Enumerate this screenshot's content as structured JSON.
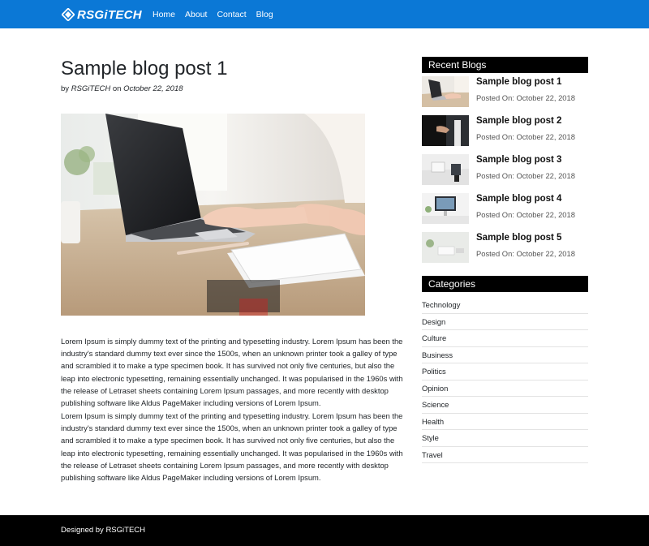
{
  "navbar": {
    "brand_text": "RSGiTECH",
    "brand_color": "#0b78d6",
    "links": [
      {
        "label": "Home"
      },
      {
        "label": "About"
      },
      {
        "label": "Contact"
      },
      {
        "label": "Blog"
      }
    ]
  },
  "post": {
    "title": "Sample blog post 1",
    "meta_by": "by",
    "author": "RSGiTECH",
    "meta_on": "on",
    "date": "October 22, 2018",
    "image_description": "laptop-on-desk-photo",
    "paragraphs": [
      "Lorem Ipsum is simply dummy text of the printing and typesetting industry. Lorem Ipsum has been the industry's standard dummy text ever since the 1500s, when an unknown printer took a galley of type and scrambled it to make a type specimen book. It has survived not only five centuries, but also the leap into electronic typesetting, remaining essentially unchanged. It was popularised in the 1960s with the release of Letraset sheets containing Lorem Ipsum passages, and more recently with desktop publishing software like Aldus PageMaker including versions of Lorem Ipsum.",
      "Lorem Ipsum is simply dummy text of the printing and typesetting industry. Lorem Ipsum has been the industry's standard dummy text ever since the 1500s, when an unknown printer took a galley of type and scrambled it to make a type specimen book. It has survived not only five centuries, but also the leap into electronic typesetting, remaining essentially unchanged. It was popularised in the 1960s with the release of Letraset sheets containing Lorem Ipsum passages, and more recently with desktop publishing software like Aldus PageMaker including versions of Lorem Ipsum."
    ]
  },
  "sidebar": {
    "recent_heading": "Recent Blogs",
    "recent": [
      {
        "title": "Sample blog post 1",
        "date": "Posted On: October 22, 2018"
      },
      {
        "title": "Sample blog post 2",
        "date": "Posted On: October 22, 2018"
      },
      {
        "title": "Sample blog post 3",
        "date": "Posted On: October 22, 2018"
      },
      {
        "title": "Sample blog post 4",
        "date": "Posted On: October 22, 2018"
      },
      {
        "title": "Sample blog post 5",
        "date": "Posted On: October 22, 2018"
      }
    ],
    "categories_heading": "Categories",
    "categories": [
      "Technology",
      "Design",
      "Culture",
      "Business",
      "Politics",
      "Opinion",
      "Science",
      "Health",
      "Style",
      "Travel"
    ]
  },
  "footer": {
    "text": "Designed by RSGiTECH"
  }
}
